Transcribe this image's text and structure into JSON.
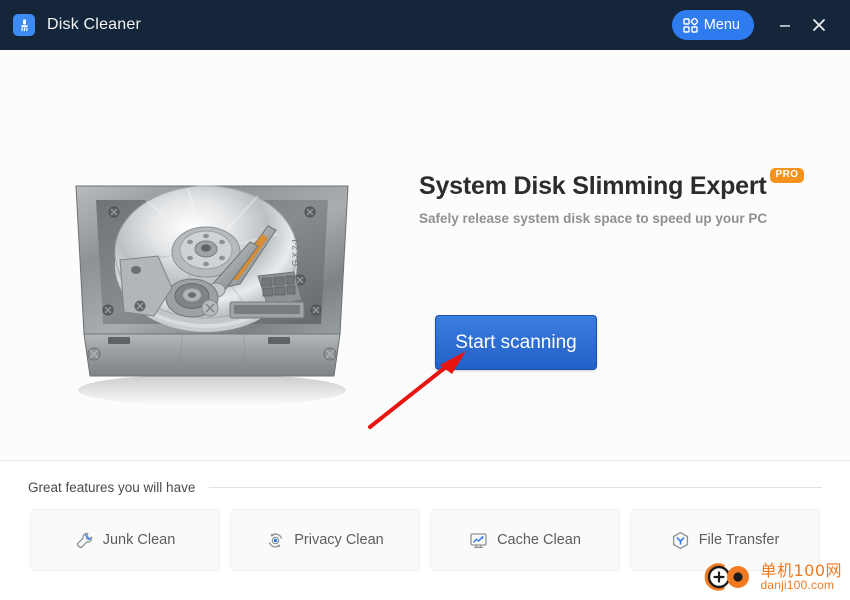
{
  "window": {
    "title": "Disk Cleaner",
    "app_icon": "broom-icon",
    "titlebar_color": "#16263a"
  },
  "titlebar": {
    "menu_label": "Menu",
    "menu_icon": "grid-menu-icon",
    "menu_color": "#2f7bf0",
    "minimize_label": "Minimize",
    "minimize_icon": "minimize-icon",
    "close_label": "Close",
    "close_icon": "close-icon"
  },
  "hero": {
    "illustration": "hard-disk-drive-illustration",
    "headline": "System Disk Slimming Expert",
    "pro_badge": "PRO",
    "pro_badge_color": "#f5921e",
    "subheadline": "Safely release system disk space to speed up your PC",
    "cta_label": "Start scanning",
    "cta_color": "#2f6fd4",
    "annotation": {
      "type": "red-arrow",
      "color": "#e8140f",
      "points_to": "Start scanning"
    }
  },
  "features": {
    "section_title": "Great features you will have",
    "cards": [
      {
        "label": "Junk Clean",
        "icon": "wrench-brush-icon"
      },
      {
        "label": "Privacy Clean",
        "icon": "refresh-circle-icon"
      },
      {
        "label": "Cache Clean",
        "icon": "monitor-chart-icon"
      },
      {
        "label": "File Transfer",
        "icon": "hexagon-download-icon"
      }
    ]
  },
  "watermark": {
    "logo": "danji100-logo",
    "text_cn": "单机100网",
    "text_en": "danji100.com",
    "color": "#ef7a21"
  }
}
